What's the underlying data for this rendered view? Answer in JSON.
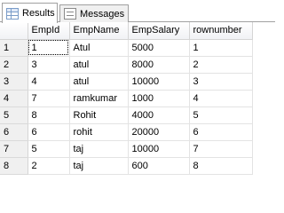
{
  "tabs": {
    "results": {
      "label": "Results",
      "icon": "grid-icon"
    },
    "messages": {
      "label": "Messages",
      "icon": "messages-icon"
    }
  },
  "grid": {
    "columns": [
      "",
      "EmpId",
      "EmpName",
      "EmpSalary",
      "rownumber"
    ],
    "rows": [
      {
        "num": "1",
        "EmpId": "1",
        "EmpName": "Atul",
        "EmpSalary": "5000",
        "rownumber": "1"
      },
      {
        "num": "2",
        "EmpId": "3",
        "EmpName": "atul",
        "EmpSalary": "8000",
        "rownumber": "2"
      },
      {
        "num": "3",
        "EmpId": "4",
        "EmpName": "atul",
        "EmpSalary": "10000",
        "rownumber": "3"
      },
      {
        "num": "4",
        "EmpId": "7",
        "EmpName": "ramkumar",
        "EmpSalary": "1000",
        "rownumber": "4"
      },
      {
        "num": "5",
        "EmpId": "8",
        "EmpName": "Rohit",
        "EmpSalary": "4000",
        "rownumber": "5"
      },
      {
        "num": "6",
        "EmpId": "6",
        "EmpName": "rohit",
        "EmpSalary": "20000",
        "rownumber": "6"
      },
      {
        "num": "7",
        "EmpId": "5",
        "EmpName": "taj",
        "EmpSalary": "10000",
        "rownumber": "7"
      },
      {
        "num": "8",
        "EmpId": "2",
        "EmpName": "taj",
        "EmpSalary": "600",
        "rownumber": "8"
      }
    ]
  }
}
